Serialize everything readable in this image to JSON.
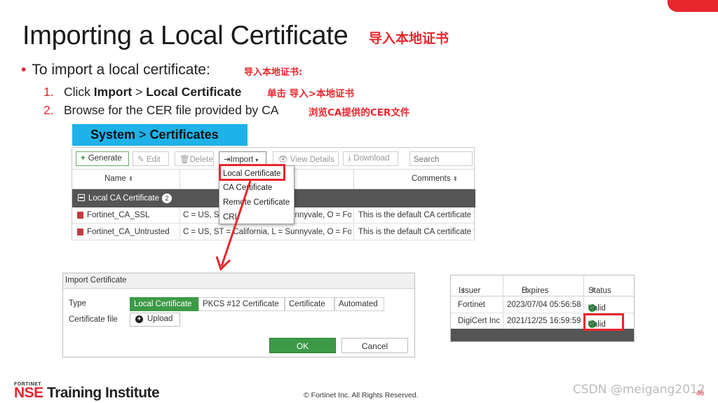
{
  "slide": {
    "title": "Importing a Local Certificate",
    "title_cn": "导入本地证书",
    "bullet": "To import a local certificate:",
    "bullet_cn": "导入本地证书:",
    "step1_num": "1.",
    "step1_pre": "Click ",
    "step1_b1": "Import",
    "step1_mid": " > ",
    "step1_b2": "Local Certificate",
    "step1_cn": "单击 导入>本地证书",
    "step2_num": "2.",
    "step2_text": "Browse for the CER file provided by CA",
    "step2_cn": "浏览CA提供的CER文件",
    "banner_b1": "System",
    "banner_sep": " > ",
    "banner_b2": "Certificates"
  },
  "toolbar": {
    "generate": "Generate",
    "edit": "Edit",
    "delete": "Delete",
    "import": "Import",
    "view_details": "View Details",
    "download": "Download",
    "search_placeholder": "Search"
  },
  "cert_table": {
    "headers": [
      "Name",
      "Comments"
    ],
    "group": {
      "label": "Local CA Certificate",
      "count": "2"
    },
    "rows": [
      {
        "name": "Fortinet_CA_SSL",
        "subject": "C = US, ST = California, L = Sunnyvale, O = Fort...",
        "comments": "This is the default CA certificate t"
      },
      {
        "name": "Fortinet_CA_Untrusted",
        "subject": "C = US, ST = California, L = Sunnyvale, O = Fort...",
        "comments": "This is the default CA certificate t"
      }
    ]
  },
  "import_menu": {
    "items": [
      "Local Certificate",
      "CA Certificate",
      "Remote Certificate",
      "CRL"
    ]
  },
  "import_dialog": {
    "title": "Import Certificate",
    "type_label": "Type",
    "types": [
      "Local Certificate",
      "PKCS #12 Certificate",
      "Certificate",
      "Automated"
    ],
    "selected_type": "Local Certificate",
    "file_label": "Certificate file",
    "upload": "Upload",
    "ok": "OK",
    "cancel": "Cancel"
  },
  "issuer_table": {
    "headers": [
      "Issuer",
      "Expires",
      "Status"
    ],
    "rows": [
      {
        "issuer": "Fortinet",
        "expires": "2023/07/04 05:56:58",
        "status": "Valid"
      },
      {
        "issuer": "DigiCert Inc",
        "expires": "2021/12/25 16:59:59",
        "status": "Valid"
      }
    ]
  },
  "footer": {
    "brand_small": "FORTINET",
    "brand_nse": "NSE",
    "brand_rest": " Training Institute",
    "copyright": "© Fortinet Inc. All Rights Reserved.",
    "watermark": "CSDN @meigang2012",
    "page": "46"
  },
  "colors": {
    "accent_red": "#e8262e",
    "banner_blue": "#1fb2e8",
    "ok_green": "#3c9a46",
    "group_gray": "#555555"
  }
}
